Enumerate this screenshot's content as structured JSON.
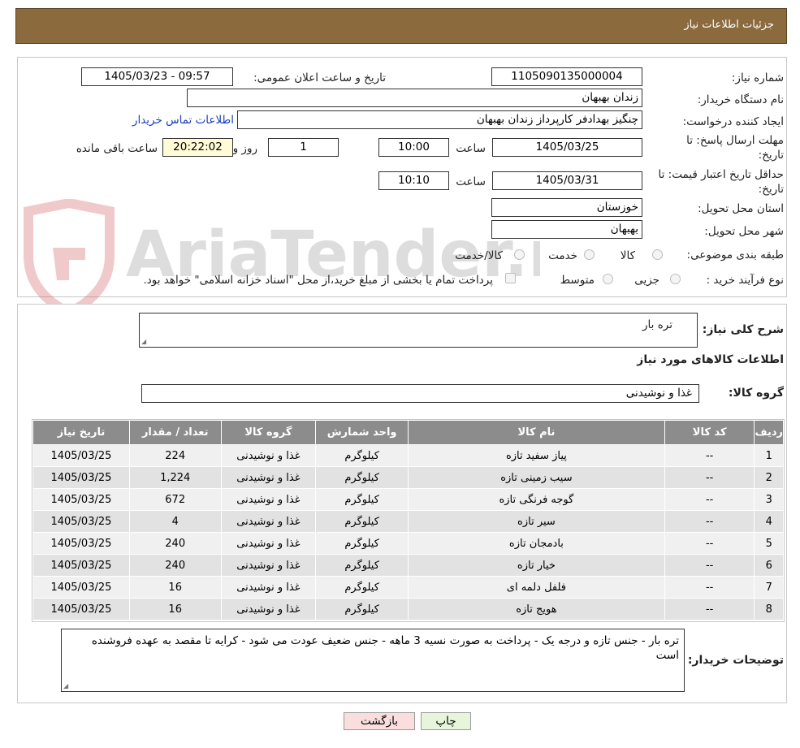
{
  "header": {
    "title": "جزئیات اطلاعات نیاز"
  },
  "watermark": {
    "text": "AriaTender.neT"
  },
  "form": {
    "need_number_label": "شماره نیاز:",
    "need_number": "1105090135000004",
    "announce_label": "تاریخ و ساعت اعلان عمومی:",
    "announce_value": "1405/03/23 - 09:57",
    "buyer_label": "نام دستگاه خریدار:",
    "buyer_value": "زندان بهبهان",
    "creator_label": "ایجاد کننده درخواست:",
    "creator_value": "چنگیز بهدادفر کارپرداز زندان بهبهان",
    "contact_link": "اطلاعات تماس خریدار",
    "reply_label_1": "مهلت ارسال پاسخ: تا",
    "reply_label_2": "تاریخ:",
    "reply_date": "1405/03/25",
    "time_label": "ساعت",
    "reply_time": "10:00",
    "days_value": "1",
    "days_label": "روز و",
    "remaining_time": "20:22:02",
    "remaining_label": "ساعت باقی مانده",
    "validity_label_1": "حداقل تاریخ اعتبار قیمت: تا",
    "validity_label_2": "تاریخ:",
    "validity_date": "1405/03/31",
    "validity_time": "10:10",
    "province_label": "استان محل تحویل:",
    "province_value": "خوزستان",
    "city_label": "شهر محل تحویل:",
    "city_value": "بهبهان",
    "category_label": "طبقه بندی موضوعی:",
    "category_options": [
      "کالا",
      "خدمت",
      "کالا/خدمت"
    ],
    "process_label": "نوع فرآیند خرید :",
    "process_options": [
      "جزیی",
      "متوسط"
    ],
    "payment_note": "پرداخت تمام یا بخشی از مبلغ خرید،از محل \"اسناد خزانه اسلامی\" خواهد بود."
  },
  "details": {
    "summary_label": "شرح کلی نیاز:",
    "summary_value": "تره بار",
    "goods_title": "اطلاعات کالاهای مورد نیاز",
    "group_label": "گروه کالا:",
    "group_value": "غذا و نوشیدنی",
    "table": {
      "headers": [
        "ردیف",
        "کد کالا",
        "نام کالا",
        "واحد شمارش",
        "گروه کالا",
        "تعداد / مقدار",
        "تاریخ نیاز"
      ],
      "rows": [
        [
          "1",
          "--",
          "پیاز سفید تازه",
          "کیلوگرم",
          "غذا و نوشیدنی",
          "224",
          "1405/03/25"
        ],
        [
          "2",
          "--",
          "سیب زمینی تازه",
          "کیلوگرم",
          "غذا و نوشیدنی",
          "1,224",
          "1405/03/25"
        ],
        [
          "3",
          "--",
          "گوجه فرنگی تازه",
          "کیلوگرم",
          "غذا و نوشیدنی",
          "672",
          "1405/03/25"
        ],
        [
          "4",
          "--",
          "سیر تازه",
          "کیلوگرم",
          "غذا و نوشیدنی",
          "4",
          "1405/03/25"
        ],
        [
          "5",
          "--",
          "بادمجان تازه",
          "کیلوگرم",
          "غذا و نوشیدنی",
          "240",
          "1405/03/25"
        ],
        [
          "6",
          "--",
          "خیار تازه",
          "کیلوگرم",
          "غذا و نوشیدنی",
          "240",
          "1405/03/25"
        ],
        [
          "7",
          "--",
          "فلفل دلمه ای",
          "کیلوگرم",
          "غذا و نوشیدنی",
          "16",
          "1405/03/25"
        ],
        [
          "8",
          "--",
          "هویج تازه",
          "کیلوگرم",
          "غذا و نوشیدنی",
          "16",
          "1405/03/25"
        ]
      ]
    },
    "buyer_notes_label": "توضیحات خریدار:",
    "buyer_notes_value": "تره بار - جنس تازه و درجه یک - پرداخت به صورت نسیه 3 ماهه - جنس ضعیف عودت می شود - کرایه تا مقصد به عهده فروشنده است"
  },
  "buttons": {
    "print": "چاپ",
    "back": "بازگشت"
  },
  "colors": {
    "header": "#8b6a3e",
    "print_button": "#e6f5dc",
    "back_button": "#fadede",
    "link": "#1a3fbf",
    "table_header": "#8c8c8c"
  }
}
